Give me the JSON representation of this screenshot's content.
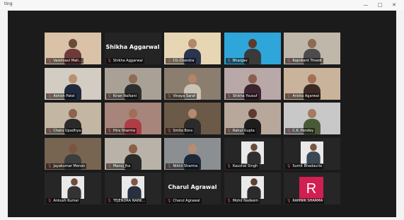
{
  "window": {
    "title": "ting",
    "minimize_glyph": "—",
    "maximize_glyph": "□",
    "close_glyph": "✕"
  },
  "colors": {
    "stage": "#1b1b1b",
    "active_outline": "#b7d86a",
    "mute_icon": "#e06060",
    "avatar_r": "#d21f52"
  },
  "participants": [
    {
      "name": "Vaishnavi Mah...",
      "mode": "video",
      "bg": "#d9c2a8",
      "skin": "#6b4a3a",
      "shirt": "#6f3a3a"
    },
    {
      "name": "Shikha Aggarwal",
      "mode": "name"
    },
    {
      "name": "CG Chandra",
      "mode": "video",
      "bg": "#e7d6b4",
      "skin": "#b2876a",
      "shirt": "#2c3550"
    },
    {
      "name": "Bhargav",
      "mode": "video",
      "bg": "#2ea6d9",
      "skin": "#5e3a2a",
      "shirt": "#3a3a3a"
    },
    {
      "name": "Rajnikant Trivedi",
      "mode": "video",
      "bg": "#bfb7a9",
      "skin": "#8e6a52",
      "shirt": "#4c4c4c"
    },
    {
      "name": "Ashish Patel",
      "mode": "video",
      "bg": "#d3ccc2",
      "skin": "#b89173",
      "shirt": "#1f2a3d"
    },
    {
      "name": "Kiran Nalkani",
      "mode": "video",
      "bg": "#a9a196",
      "skin": "#8f6b54",
      "shirt": "#2e2e2e"
    },
    {
      "name": "Vinaya Saraf",
      "mode": "video",
      "bg": "#8c7e6f",
      "skin": "#b28468",
      "shirt": "#c9c2b5"
    },
    {
      "name": "Shikha Yousuf",
      "mode": "video",
      "bg": "#b9a8a8",
      "skin": "#8a5e4d",
      "shirt": "#3c2430"
    },
    {
      "name": "Ankita Agarwal",
      "mode": "video",
      "bg": "#c9b39a",
      "skin": "#a36f57",
      "shirt": "#3b2a25",
      "active": true
    },
    {
      "name": "Charu Upadhya",
      "mode": "video",
      "bg": "#c3b6a3",
      "skin": "#8d6350",
      "shirt": "#2a2a2a"
    },
    {
      "name": "Hira Sharma",
      "mode": "video",
      "bg": "#a8857b",
      "skin": "#a06e56",
      "shirt": "#b03d45"
    },
    {
      "name": "Smita Bora",
      "mode": "video",
      "bg": "#6c5a48",
      "skin": "#b58b6f",
      "shirt": "#2b2b2b"
    },
    {
      "name": "Rahul Gupta",
      "mode": "video",
      "bg": "#b7a89b",
      "skin": "#5c3b2e",
      "shirt": "#1d1d1d"
    },
    {
      "name": "C.K. Pandey",
      "mode": "video",
      "bg": "#c8c8c8",
      "skin": "#a57b61",
      "shirt": "#4a5a38"
    },
    {
      "name": "Jayakumar Menon",
      "mode": "video",
      "bg": "#776552",
      "skin": "#7a5441",
      "shirt": "#3d3d3d"
    },
    {
      "name": "Manoj Jha",
      "mode": "video",
      "bg": "#b8b2a8",
      "skin": "#8b5f48",
      "shirt": "#2a2a2a"
    },
    {
      "name": "Nikhil Sharma",
      "mode": "video",
      "bg": "#8b8f92",
      "skin": "#b98c70",
      "shirt": "#1f2837"
    },
    {
      "name": "Kaushal Singh",
      "mode": "photo",
      "skin": "#6a4a3a",
      "shirt": "#2f2f2f"
    },
    {
      "name": "Sumit Bhadauria",
      "mode": "photo",
      "skin": "#7a5643",
      "shirt": "#3a4754"
    },
    {
      "name": "Ankush Kumar",
      "mode": "photo",
      "skin": "#6f4d3b",
      "shirt": "#333333"
    },
    {
      "name": "TEJENDRA NAINI...",
      "mode": "photo",
      "skin": "#7d5745",
      "shirt": "#26303f"
    },
    {
      "name": "Charul Agrawal",
      "mode": "name"
    },
    {
      "name": "Mohd Nadeem",
      "mode": "photo",
      "skin": "#5f4030",
      "shirt": "#2b2b2b"
    },
    {
      "name": "RAMNIK SHARMA",
      "mode": "avatar",
      "letter": "R"
    }
  ]
}
